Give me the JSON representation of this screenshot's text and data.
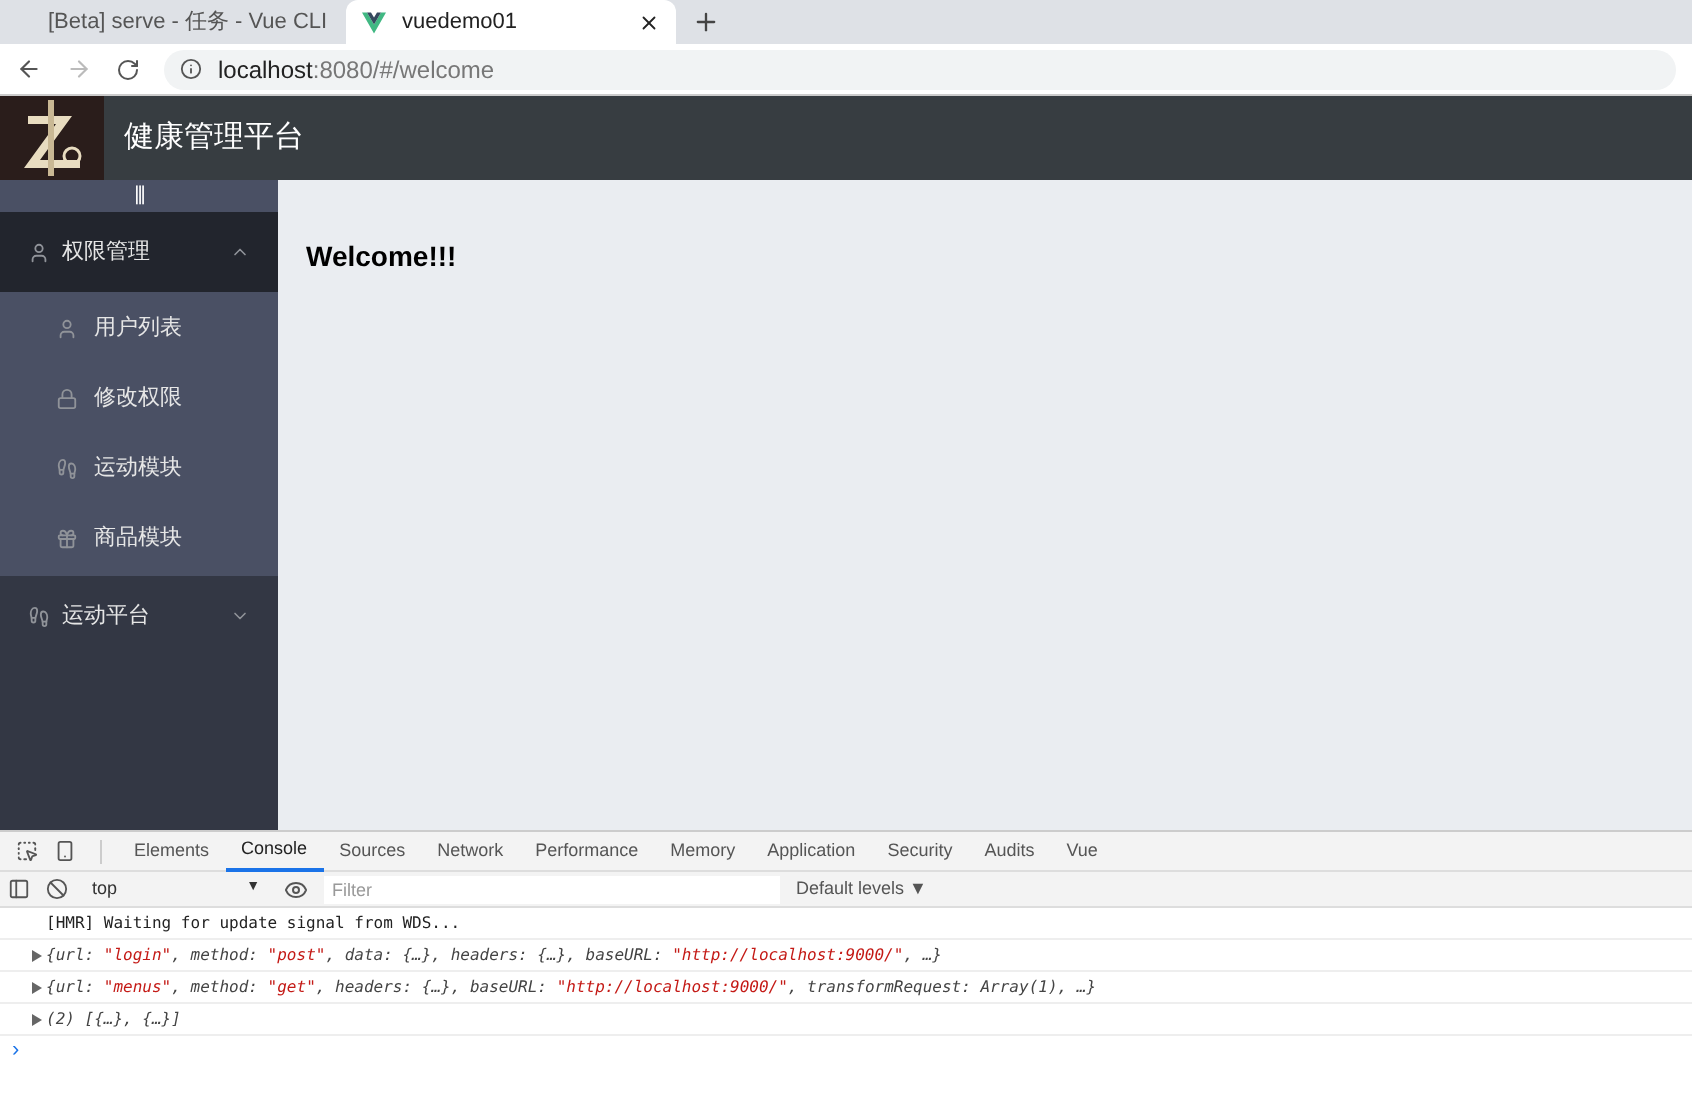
{
  "browser_tabs": [
    {
      "title": "[Beta] serve - 任务 - Vue CLI",
      "selected": false
    },
    {
      "title": "vuedemo01",
      "selected": true
    }
  ],
  "address_bar": {
    "url_host": "localhost",
    "url_rest": ":8080/#/welcome"
  },
  "header": {
    "title": "健康管理平台"
  },
  "sidebar": {
    "toggle": "|||",
    "menus": [
      {
        "label": "权限管理",
        "expanded": true,
        "hovered": true,
        "children": [
          {
            "label": "用户列表"
          },
          {
            "label": "修改权限"
          },
          {
            "label": "运动模块"
          },
          {
            "label": "商品模块"
          }
        ]
      },
      {
        "label": "运动平台",
        "expanded": false,
        "hovered": false
      }
    ]
  },
  "main": {
    "heading": "Welcome!!!"
  },
  "devtools": {
    "tabs": [
      {
        "label": "Elements",
        "selected": false
      },
      {
        "label": "Console",
        "selected": true
      },
      {
        "label": "Sources",
        "selected": false
      },
      {
        "label": "Network",
        "selected": false
      },
      {
        "label": "Performance",
        "selected": false
      },
      {
        "label": "Memory",
        "selected": false
      },
      {
        "label": "Application",
        "selected": false
      },
      {
        "label": "Security",
        "selected": false
      },
      {
        "label": "Audits",
        "selected": false
      },
      {
        "label": "Vue",
        "selected": false
      }
    ],
    "context": "top",
    "context_arrow": "▼",
    "filter": {
      "placeholder": "Filter"
    },
    "levels": "Default levels ▼",
    "lines": [
      {
        "expandable": false,
        "segments": [
          {
            "kind": "plain",
            "text": "[HMR] Waiting for update signal from WDS..."
          }
        ]
      },
      {
        "expandable": true,
        "segments": [
          {
            "kind": "key",
            "text": "{url: "
          },
          {
            "kind": "string",
            "text": "\"login\""
          },
          {
            "kind": "key",
            "text": ", method: "
          },
          {
            "kind": "string",
            "text": "\"post\""
          },
          {
            "kind": "key",
            "text": ", data: {…}, headers: {…}, baseURL: "
          },
          {
            "kind": "string",
            "text": "\"http://localhost:9000/\""
          },
          {
            "kind": "key",
            "text": ", …}"
          }
        ]
      },
      {
        "expandable": true,
        "segments": [
          {
            "kind": "key",
            "text": "{url: "
          },
          {
            "kind": "string",
            "text": "\"menus\""
          },
          {
            "kind": "key",
            "text": ", method: "
          },
          {
            "kind": "string",
            "text": "\"get\""
          },
          {
            "kind": "key",
            "text": ", headers: {…}, baseURL: "
          },
          {
            "kind": "string",
            "text": "\"http://localhost:9000/\""
          },
          {
            "kind": "key",
            "text": ", transformRequest: Array(1), …}"
          }
        ]
      },
      {
        "expandable": true,
        "segments": [
          {
            "kind": "key",
            "text": "(2) [{…}, {…}]"
          }
        ]
      }
    ],
    "prompt": "›"
  }
}
